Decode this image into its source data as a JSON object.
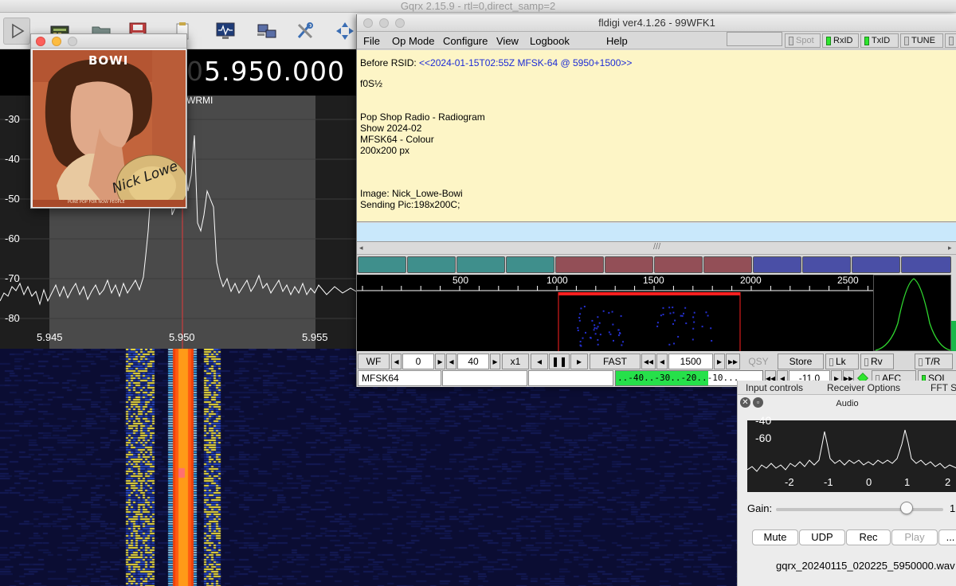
{
  "gqrx": {
    "title": "Gqrx 2.15.9 - rtl=0,direct_samp=2",
    "freq_prefix": "0",
    "frequency": "5.950.000",
    "station_label": "WRMI",
    "y_ticks": [
      "-30",
      "-40",
      "-50",
      "-60",
      "-70",
      "-80"
    ],
    "x_ticks": [
      "5.945",
      "5.950",
      "5.955"
    ],
    "toolbar_icons": [
      "play-icon",
      "hardware-icon",
      "folder-icon",
      "save-icon",
      "clipboard-icon",
      "monitor-icon",
      "network-icon",
      "tools-icon",
      "move-icon"
    ]
  },
  "image_window": {
    "album_title": "BOWI",
    "signature": "Nick Lowe",
    "footer": "PURE POP FOR NOW PEOPLE"
  },
  "fldigi": {
    "title": "fldigi ver4.1.26 - 99WFK1",
    "menu": [
      "File",
      "Op Mode",
      "Configure",
      "View",
      "Logbook",
      "Help"
    ],
    "toggles": [
      {
        "label": "Spot",
        "on": false
      },
      {
        "label": "RxID",
        "on": true
      },
      {
        "label": "TxID",
        "on": true
      },
      {
        "label": "TUNE",
        "on": false
      }
    ],
    "rx_lines": {
      "rsid_prefix": "Before RSID: ",
      "rsid": "<<2024-01-15T02:55Z MFSK-64 @ 5950+1500>>",
      "garbage": "f0S½",
      "line1": "Pop Shop Radio - Radiogram",
      "line2": "Show 2024-02",
      "line3": "MFSK64 - Colour",
      "line4": "200x200 px",
      "line5": "Image: Nick_Lowe-Bowi",
      "line6": "Sending Pic:198x200C;"
    },
    "scale_ticks": [
      "500",
      "1000",
      "1500",
      "2000",
      "2500"
    ],
    "controls": {
      "wf": "WF",
      "lower": "0",
      "range": "40",
      "zoom": "x1",
      "speed": "FAST",
      "carrier": "1500",
      "qsy": "QSY",
      "store": "Store",
      "lk": "Lk",
      "rv": "Rv",
      "tr": "T/R"
    },
    "status": {
      "mode": "MFSK64",
      "meter": "..-40..-30..-20..-10...",
      "squelch": "-11.0",
      "afc": "AFC",
      "sql": "SQL"
    }
  },
  "audio_dock": {
    "tabs": [
      "Input controls",
      "Receiver Options",
      "FFT Se"
    ],
    "header": "Audio",
    "fft_y": [
      "-40",
      "-60"
    ],
    "fft_x": [
      "-2",
      "-1",
      "0",
      "1",
      "2"
    ],
    "gain_label": "Gain:",
    "gain_value": "1",
    "gain_level": 0.78,
    "buttons": {
      "mute": "Mute",
      "udp": "UDP",
      "rec": "Rec",
      "play": "Play",
      "more": "..."
    },
    "recording_file": "gqrx_20240115_020225_5950000.wav"
  },
  "colors": {
    "rx_bg": "#fdf5c6",
    "tx_bg": "#c9e8fb",
    "led_on": "#2ee62e",
    "macro_teal": "#3f8f8c",
    "macro_red": "#934f57",
    "macro_blue": "#4a4fa6"
  }
}
